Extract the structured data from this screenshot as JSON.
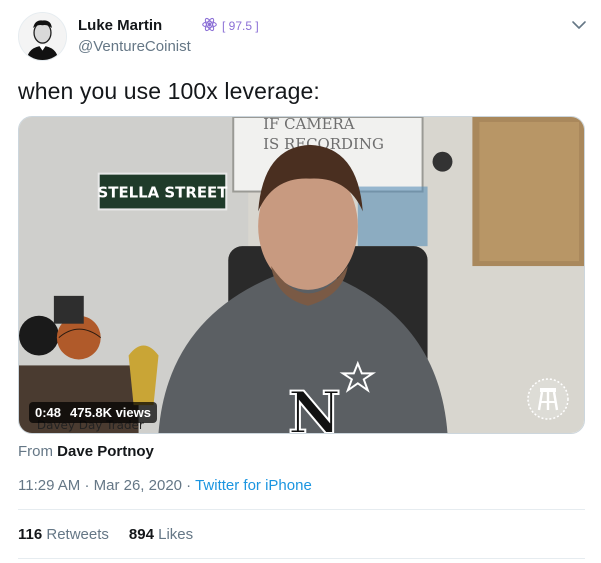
{
  "author": {
    "name": "Luke Martin",
    "handle": "@VentureCoinist",
    "badge_score": "[ 97.5 ]"
  },
  "tweet": {
    "text": "when you use 100x leverage:"
  },
  "video": {
    "duration": "0:48",
    "views": "475.8K views",
    "scene_text": {
      "sign": "STELLA STREET",
      "whiteboard_line1": "IF CAMERA",
      "whiteboard_line2": "IS RECORDING",
      "bottom_sign": "Davey Day Trader",
      "shirt_letter": "N"
    }
  },
  "from": {
    "prefix": "From",
    "name": "Dave Portnoy"
  },
  "meta": {
    "time": "11:29 AM",
    "separator1": "·",
    "date": "Mar 26, 2020",
    "separator2": "·",
    "source": "Twitter for iPhone"
  },
  "stats": {
    "retweets_count": "116",
    "retweets_label": "Retweets",
    "likes_count": "894",
    "likes_label": "Likes"
  },
  "colors": {
    "link": "#1b95e0",
    "secondary_text": "#657786",
    "primary_text": "#14171a",
    "badge": "#8b6fd6"
  }
}
